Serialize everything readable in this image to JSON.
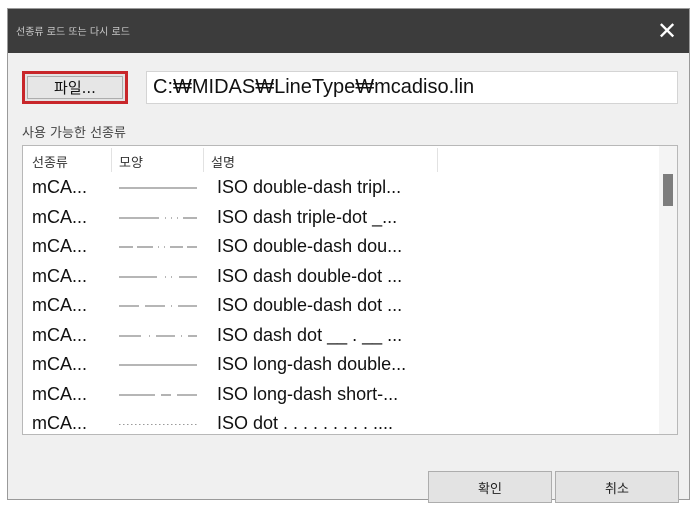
{
  "dialog": {
    "title": "선종류 로드 또는 다시 로드",
    "close_glyph": "✕"
  },
  "file_button": {
    "label": "파일..."
  },
  "path_field": {
    "value": "C:₩MIDAS₩LineType₩mcadiso.lin"
  },
  "available_label": "사용 가능한 선종류",
  "list": {
    "headers": [
      "선종류",
      "모양",
      "설명"
    ],
    "rows": [
      {
        "name": "mCA...",
        "pattern": "solid",
        "description": "ISO double-dash tripl..."
      },
      {
        "name": "mCA...",
        "pattern": "dash-triple-dot",
        "description": "ISO dash triple-dot _..."
      },
      {
        "name": "mCA...",
        "pattern": "double-dash-double-dot",
        "description": "ISO double-dash dou..."
      },
      {
        "name": "mCA...",
        "pattern": "dash-double-dot",
        "description": "ISO dash double-dot ..."
      },
      {
        "name": "mCA...",
        "pattern": "double-dash-dot",
        "description": "ISO double-dash dot ..."
      },
      {
        "name": "mCA...",
        "pattern": "dash-dot",
        "description": "ISO dash dot __ . __ ..."
      },
      {
        "name": "mCA...",
        "pattern": "long-dash-double",
        "description": "ISO long-dash double..."
      },
      {
        "name": "mCA...",
        "pattern": "long-dash-short",
        "description": "ISO long-dash short-..."
      },
      {
        "name": "mCA...",
        "pattern": "dot",
        "description": "ISO dot . . . . . . . . . ...."
      }
    ]
  },
  "buttons": {
    "ok": "확인",
    "cancel": "취소"
  },
  "colors": {
    "titlebar": "#3c3c3c",
    "highlight": "#c8262a",
    "dialog_bg": "#f0f0f0"
  }
}
